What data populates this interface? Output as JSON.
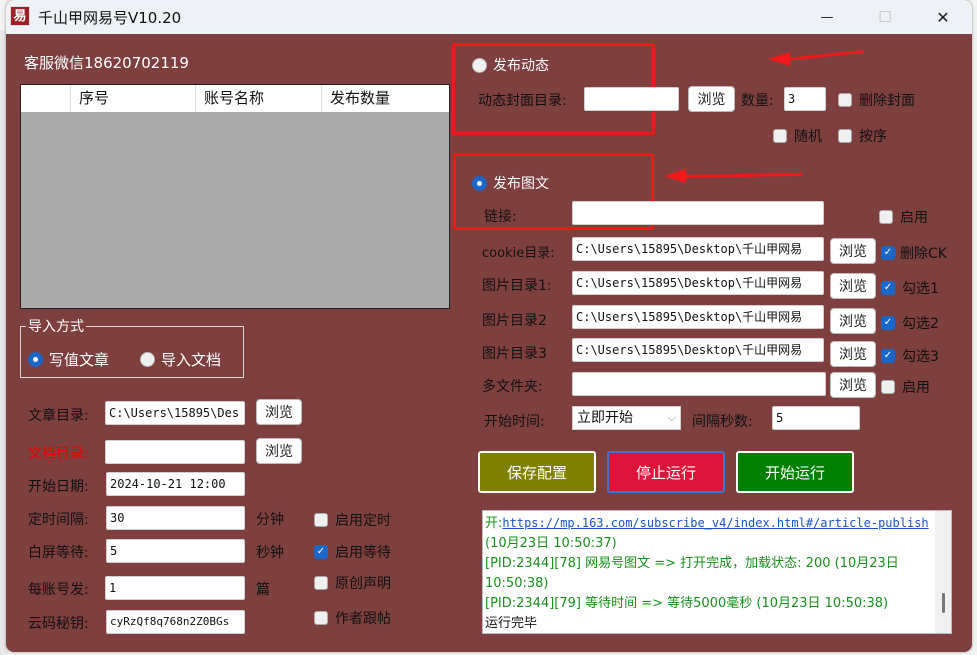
{
  "window": {
    "title": "千山甲网易号V10.20",
    "app_icon_glyph": "易",
    "controls": {
      "minimize": "—",
      "maximize": "☐",
      "close": "✕"
    }
  },
  "support": "客服微信18620702119",
  "accounts_table": {
    "columns": [
      "",
      "序号",
      "账号名称",
      "发布数量"
    ],
    "rows": []
  },
  "import_mode": {
    "legend": "导入方式",
    "options": [
      {
        "label": "写值文章",
        "selected": true
      },
      {
        "label": "导入文档",
        "selected": false
      }
    ]
  },
  "left_form": {
    "article_dir": {
      "label": "文章目录:",
      "value": "C:\\Users\\15895\\Des",
      "browse": "浏览"
    },
    "doc_dir": {
      "label": "文档目录:",
      "value": "",
      "browse": "浏览"
    },
    "start_date": {
      "label": "开始日期:",
      "value": "2024-10-21 12:00"
    },
    "timer_interval": {
      "label": "定时间隔:",
      "value": "30",
      "unit": "分钟"
    },
    "white_wait": {
      "label": "白屏等待:",
      "value": "5",
      "unit": "秒钟"
    },
    "per_account": {
      "label": "每账号发:",
      "value": "1",
      "unit": "篇"
    },
    "cloud_key": {
      "label": "云码秘钥:",
      "value": "cyRzQf8q768n2Z0BGs"
    },
    "checkboxes": [
      {
        "label": "启用定时",
        "checked": false
      },
      {
        "label": "启用等待",
        "checked": true
      },
      {
        "label": "原创声明",
        "checked": false
      },
      {
        "label": "作者跟帖",
        "checked": false
      }
    ]
  },
  "dynamic": {
    "radio_label": "发布动态",
    "selected": false,
    "cover_dir_label": "动态封面目录:",
    "cover_dir_value": "",
    "browse": "浏览",
    "count_label": "数量:",
    "count_value": "3",
    "delete_cover": {
      "label": "删除封面",
      "checked": false
    },
    "random": {
      "label": "随机",
      "checked": false
    },
    "ordered": {
      "label": "按序",
      "checked": false
    }
  },
  "article": {
    "radio_label": "发布图文",
    "selected": true,
    "link": {
      "label": "链接:",
      "value": "",
      "enable": {
        "label": "启用",
        "checked": false
      }
    },
    "cookie_dir": {
      "label": "cookie目录:",
      "value": "C:\\Users\\15895\\Desktop\\千山甲网易",
      "browse": "浏览",
      "check": {
        "label": "删除CK",
        "checked": true
      }
    },
    "image_dirs": [
      {
        "label": "图片目录1:",
        "value": "C:\\Users\\15895\\Desktop\\千山甲网易",
        "browse": "浏览",
        "check": {
          "label": "勾选1",
          "checked": true
        }
      },
      {
        "label": "图片目录2",
        "value": "C:\\Users\\15895\\Desktop\\千山甲网易",
        "browse": "浏览",
        "check": {
          "label": "勾选2",
          "checked": true
        }
      },
      {
        "label": "图片目录3",
        "value": "C:\\Users\\15895\\Desktop\\千山甲网易",
        "browse": "浏览",
        "check": {
          "label": "勾选3",
          "checked": true
        }
      }
    ],
    "multi_folder": {
      "label": "多文件夹:",
      "value": "",
      "browse": "浏览",
      "check": {
        "label": "启用",
        "checked": false
      }
    },
    "start_time": {
      "label": "开始时间:",
      "value": "立即开始"
    },
    "interval": {
      "label": "间隔秒数:",
      "value": "5"
    }
  },
  "actions": {
    "save": {
      "label": "保存配置",
      "color": "#808000"
    },
    "stop": {
      "label": "停止运行",
      "color": "#dc143c"
    },
    "start": {
      "label": "开始运行",
      "color": "#008000"
    }
  },
  "log": {
    "line1_prefix": "开:",
    "line1_link": "https://mp.163.com/subscribe_v4/index.html#/article-publish",
    "line1_suffix": " (10月23日 10:50:37)",
    "line2": "[PID:2344][78] 网易号图文 => 打开完成，加载状态: 200 (10月23日 10:50:38)",
    "line3": "[PID:2344][79] 等待时间 => 等待5000毫秒 (10月23日 10:50:38)",
    "line4": "运行完毕"
  },
  "colors": {
    "window_bg": "#7e3f3f",
    "annotation_red": "#f01818",
    "log_green": "#179019"
  }
}
